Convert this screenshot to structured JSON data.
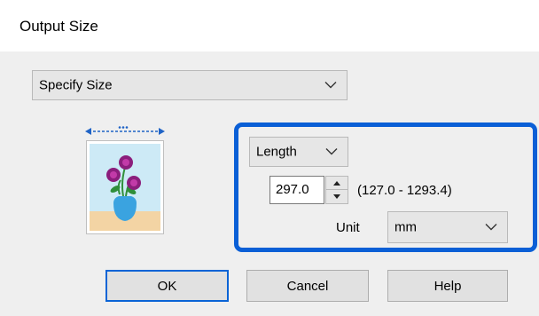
{
  "dialog": {
    "title": "Output Size"
  },
  "size_mode": {
    "selected": "Specify Size"
  },
  "orientation": {
    "selected": "Length"
  },
  "length_field": {
    "value": "297.0",
    "range": "(127.0 - 1293.4)"
  },
  "unit": {
    "label": "Unit",
    "selected": "mm"
  },
  "buttons": {
    "ok": "OK",
    "cancel": "Cancel",
    "help": "Help"
  },
  "colors": {
    "highlight": "#0a5fd6",
    "default_button_border": "#0a64d6"
  }
}
